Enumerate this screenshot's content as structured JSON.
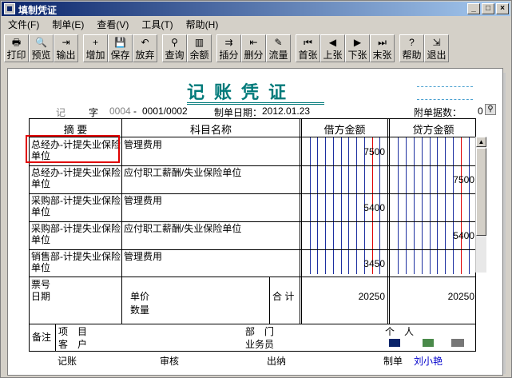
{
  "window": {
    "title": "填制凭证",
    "controls": [
      "_",
      "□",
      "×"
    ]
  },
  "menu": [
    "文件(F)",
    "制单(E)",
    "查看(V)",
    "工具(T)",
    "帮助(H)"
  ],
  "toolbar": {
    "groups": [
      [
        {
          "label": "打印",
          "icon": "printer-icon",
          "glyph": "🖶"
        },
        {
          "label": "预览",
          "icon": "preview-icon",
          "glyph": "🔍"
        },
        {
          "label": "输出",
          "icon": "export-icon",
          "glyph": "⇥"
        }
      ],
      [
        {
          "label": "增加",
          "icon": "add-icon",
          "glyph": "+"
        },
        {
          "label": "保存",
          "icon": "save-icon",
          "glyph": "💾"
        },
        {
          "label": "放弃",
          "icon": "undo-icon",
          "glyph": "↶"
        }
      ],
      [
        {
          "label": "查询",
          "icon": "binoculars-icon",
          "glyph": "⚲"
        },
        {
          "label": "余额",
          "icon": "bar-chart-icon",
          "glyph": "▥"
        }
      ],
      [
        {
          "label": "插分",
          "icon": "insert-row-icon",
          "glyph": "⇉"
        },
        {
          "label": "删分",
          "icon": "delete-row-icon",
          "glyph": "⇤"
        },
        {
          "label": "流量",
          "icon": "flow-icon",
          "glyph": "✎"
        }
      ],
      [
        {
          "label": "首张",
          "icon": "first-icon",
          "glyph": "⏮"
        },
        {
          "label": "上张",
          "icon": "prev-icon",
          "glyph": "◀"
        },
        {
          "label": "下张",
          "icon": "next-icon",
          "glyph": "▶"
        },
        {
          "label": "末张",
          "icon": "last-icon",
          "glyph": "⏭"
        }
      ],
      [
        {
          "label": "帮助",
          "icon": "help-icon",
          "glyph": "?"
        },
        {
          "label": "退出",
          "icon": "exit-icon",
          "glyph": "⇲"
        }
      ]
    ]
  },
  "voucher": {
    "title": "记账凭证",
    "type": "记",
    "zi": "字",
    "number_gray": "0004",
    "dash": "-",
    "number": "0001/0002",
    "date_label": "制单日期：",
    "date": "2012.01.23",
    "attach_label": "附单据数：",
    "attach_count": "0",
    "headers": {
      "summary": "摘 要",
      "account": "科目名称",
      "debit": "借方金额",
      "credit": "贷方金额"
    },
    "rows": [
      {
        "summary": "总经办-计提失业保险单位",
        "account": "管理费用",
        "debit": "7500",
        "credit": ""
      },
      {
        "summary": "总经办-计提失业保险单位",
        "account": "应付职工薪酬/失业保险单位",
        "debit": "",
        "credit": "7500"
      },
      {
        "summary": "采购部-计提失业保险单位",
        "account": "管理费用",
        "debit": "5400",
        "credit": ""
      },
      {
        "summary": "采购部-计提失业保险单位",
        "account": "应付职工薪酬/失业保险单位",
        "debit": "",
        "credit": "5400"
      },
      {
        "summary": "销售部-计提失业保险单位",
        "account": "管理费用",
        "debit": "3450",
        "credit": ""
      }
    ],
    "totals": {
      "ticket_no_label": "票号",
      "date_label": "日期",
      "unit_price_label": "单价",
      "quantity_label": "数量",
      "total_label": "合 计",
      "debit_total": "20250",
      "credit_total": "20250"
    },
    "remarks": {
      "label": "备注",
      "project_label": "项　目",
      "department_label": "部　门",
      "person_label": "个　人",
      "customer_label": "客　户",
      "salesperson_label": "业务员"
    },
    "signatures": {
      "bookkeeping": "记账",
      "review": "审核",
      "cashier": "出纳",
      "maker_label": "制单",
      "maker": "刘小艳"
    }
  },
  "colors": {
    "title": "#007a7a",
    "highlight": "#e00000",
    "maker": "#0000cc"
  }
}
